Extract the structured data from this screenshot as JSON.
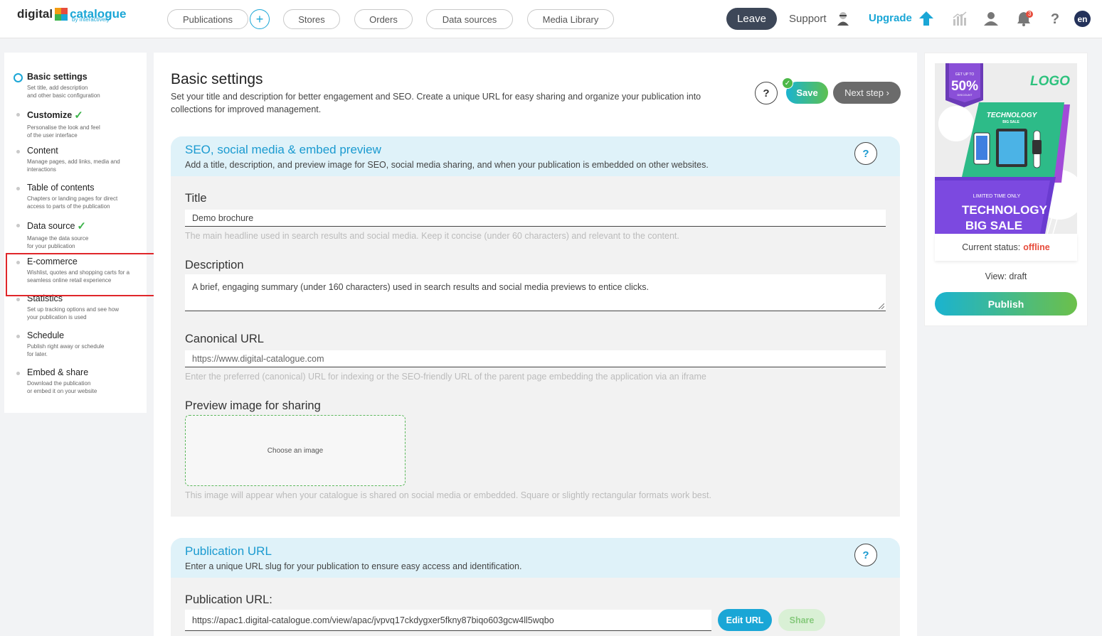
{
  "brand": {
    "name_left": "digital",
    "name_right": "catalogue",
    "tagline": "by interactively"
  },
  "topnav": {
    "items": [
      "Publications",
      "Stores",
      "Orders",
      "Data sources",
      "Media Library"
    ],
    "add_label": "+",
    "leave_label": "Leave",
    "support_label": "Support",
    "upgrade_label": "Upgrade",
    "notification_count": "3",
    "language": "en"
  },
  "sidebar": {
    "steps": [
      {
        "title": "Basic settings",
        "desc1": "Set title, add description",
        "desc2": "and other basic configuration"
      },
      {
        "title": "Customize",
        "desc1": "Personalise the look and feel",
        "desc2": "of the user interface"
      },
      {
        "title": "Content",
        "desc1": "Manage pages, add links, media and",
        "desc2": "interactions"
      },
      {
        "title": "Table of contents",
        "desc1": "Chapters or landing pages for direct",
        "desc2": "access to parts of the publication"
      },
      {
        "title": "Data source",
        "desc1": "Manage the data source",
        "desc2": "for your publication"
      },
      {
        "title": "E-commerce",
        "desc1": "Wishlist, quotes and shopping carts for a",
        "desc2": "seamless online retail experience"
      },
      {
        "title": "Statistics",
        "desc1": "Set up tracking options and see how",
        "desc2": "your publication is used"
      },
      {
        "title": "Schedule",
        "desc1": "Publish right away or schedule",
        "desc2": "for later."
      },
      {
        "title": "Embed & share",
        "desc1": "Download the publication",
        "desc2": "or embed it on your website"
      }
    ]
  },
  "header": {
    "title": "Basic settings",
    "description": "Set your title and description for better engagement and SEO. Create a unique URL for easy sharing and organize your publication into collections for improved management.",
    "help_label": "?",
    "save_label": "Save",
    "next_label": "Next step ›"
  },
  "seo": {
    "title": "SEO, social media & embed preview",
    "description": "Add a title, description, and preview image for SEO, social media sharing, and when your publication is embedded on other websites.",
    "help_label": "?",
    "title_label": "Title",
    "title_value": "Demo brochure",
    "title_hint": "The main headline used in search results and social media. Keep it concise (under 60 characters) and relevant to the content.",
    "desc_label": "Description",
    "desc_placeholder": "A brief, engaging summary (under 160 characters) used in search results and social media previews to entice clicks.",
    "canonical_label": "Canonical URL",
    "canonical_placeholder": "https://www.digital-catalogue.com",
    "canonical_hint": "Enter the preferred (canonical) URL for indexing or the SEO-friendly URL of the parent page embedding the application via an iframe",
    "image_label": "Preview image for sharing",
    "image_choose": "Choose an image",
    "image_hint": "This image will appear when your catalogue is shared on social media or embedded. Square or slightly rectangular formats work best."
  },
  "pub_url": {
    "title": "Publication URL",
    "description": "Enter a unique URL slug for your publication to ensure easy access and identification.",
    "help_label": "?",
    "label": "Publication URL:",
    "value": "https://apac1.digital-catalogue.com/view/apac/jvpvq17ckdygxer5fkny87biqo603gcw4ll5wqbo",
    "edit_label": "Edit URL",
    "share_label": "Share"
  },
  "preview": {
    "badge_top": "GET UP TO",
    "badge_pct": "50%",
    "badge_bottom": "DISCOUNT",
    "logo": "LOGO",
    "card_title": "TECHNOLOGY",
    "card_sub": "BIG SALE",
    "limited": "LIMITED TIME ONLY",
    "big1": "TECHNOLOGY",
    "big2": "BIG SALE",
    "status_label": "Current status:",
    "status_value": "offline",
    "view_label": "View: draft",
    "publish_label": "Publish"
  },
  "colors": {
    "accent": "#1aa6d6",
    "offline": "#e74c3c",
    "check": "#3cb34a",
    "highlight": "#e0262a"
  }
}
